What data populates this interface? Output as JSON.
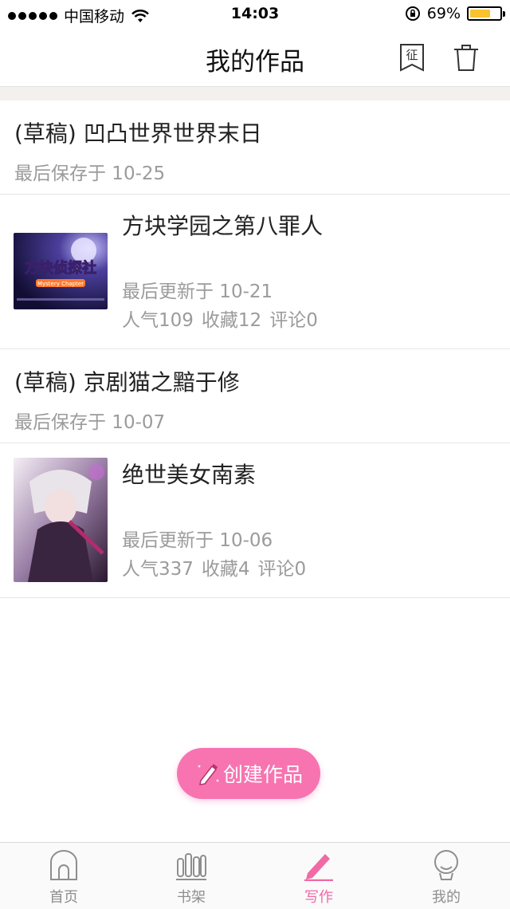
{
  "status_bar": {
    "carrier": "中国移动",
    "time": "14:03",
    "battery": "69%",
    "battery_level": 0.69
  },
  "nav": {
    "title": "我的作品",
    "contest_icon_label": "征"
  },
  "works": [
    {
      "type": "draft",
      "title": "(草稿) 凹凸世界世界末日",
      "subtitle": "最后保存于 10-25"
    },
    {
      "type": "work",
      "title": "方块学园之第八罪人",
      "updated": "最后更新于 10-21",
      "views": "人气109",
      "favorites": "收藏12",
      "comments": "评论0",
      "cover_text": "方块侦探社",
      "cover_subtext": "Mystery Chapter"
    },
    {
      "type": "draft",
      "title": "(草稿) 京剧猫之黯于修",
      "subtitle": "最后保存于 10-07"
    },
    {
      "type": "work",
      "title": "绝世美女南素",
      "updated": "最后更新于 10-06",
      "views": "人气337",
      "favorites": "收藏4",
      "comments": "评论0"
    }
  ],
  "create_button": {
    "label": "创建作品"
  },
  "tabbar": {
    "items": [
      {
        "label": "首页",
        "icon": "home-icon"
      },
      {
        "label": "书架",
        "icon": "bookshelf-icon"
      },
      {
        "label": "写作",
        "icon": "pencil-icon",
        "active": true
      },
      {
        "label": "我的",
        "icon": "profile-icon"
      }
    ],
    "active_color": "#f06aa5"
  },
  "colors": {
    "accent": "#f774b1",
    "secondary_text": "#9b9b9b"
  }
}
